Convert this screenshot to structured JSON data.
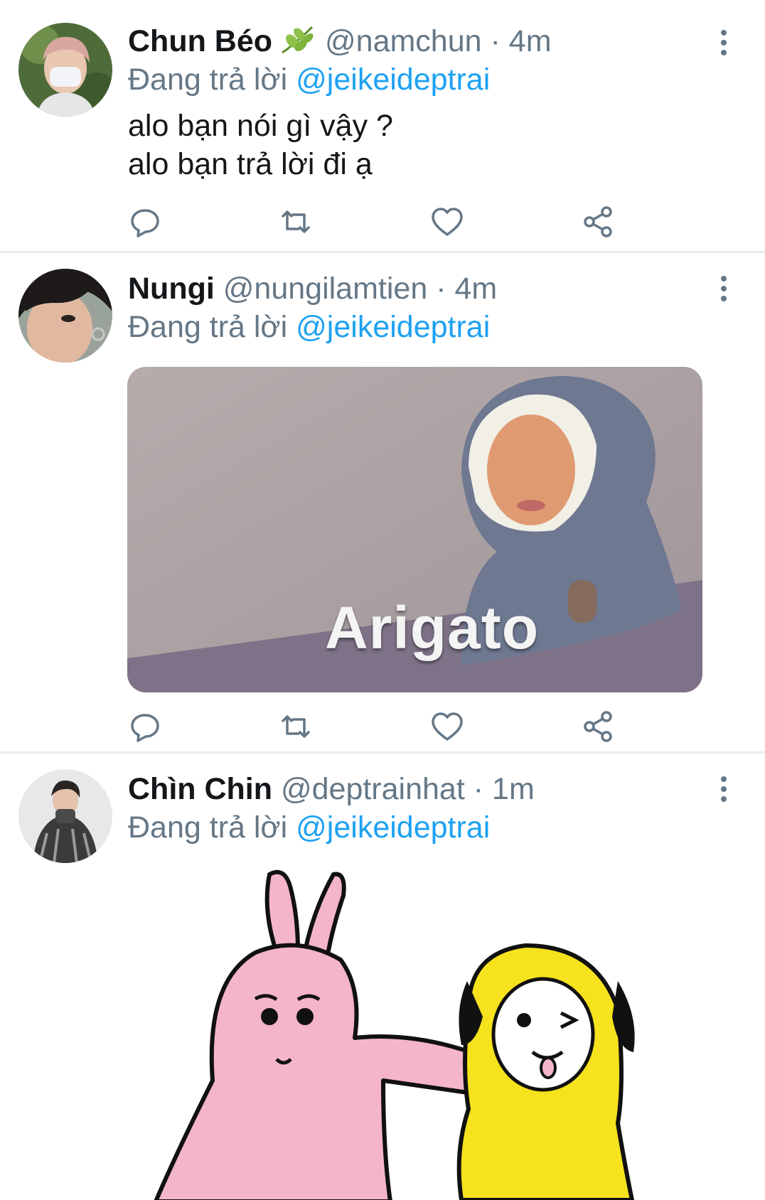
{
  "colors": {
    "accent": "#1da1f2",
    "muted": "#657786",
    "text": "#14171a",
    "divider": "#e6ecf0"
  },
  "tweets": [
    {
      "name": "Chun Béo",
      "handle": "@namchun",
      "dot": "·",
      "time": "4m",
      "reply_prefix": "Đang trả lời",
      "reply_to": "@jeikeideptrai",
      "text_lines": [
        "alo bạn nói gì vậy ?",
        "alo bạn trả lời đi ạ"
      ],
      "badge_icon": "leaf-emoji-icon"
    },
    {
      "name": "Nungi",
      "handle": "@nungilamtien",
      "dot": "·",
      "time": "4m",
      "reply_prefix": "Đang trả lời",
      "reply_to": "@jeikeideptrai",
      "media_caption": "Arigato"
    },
    {
      "name": "Chìn Chin",
      "handle": "@deptrainhat",
      "dot": "·",
      "time": "1m",
      "reply_prefix": "Đang trả lời",
      "reply_to": "@jeikeideptrai"
    }
  ]
}
